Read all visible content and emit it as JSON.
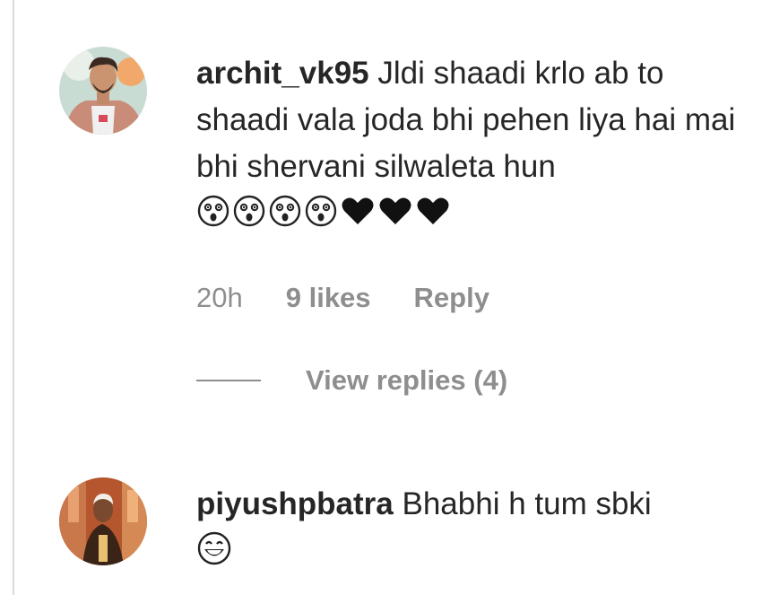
{
  "comments": [
    {
      "username": "archit_vk95",
      "text": "Jldi shaadi krlo ab to shaadi vala joda bhi pehen liya hai mai bhi shervani silwaleta hun",
      "emojis": [
        "astonished-face",
        "astonished-face",
        "astonished-face",
        "astonished-face",
        "black-heart",
        "black-heart",
        "black-heart"
      ],
      "time": "20h",
      "likes": "9 likes",
      "reply_label": "Reply",
      "view_replies": "View replies (4)"
    },
    {
      "username": "piyushpbatra",
      "text": "Bhabhi h tum sbki",
      "emojis": [
        "grinning-face"
      ]
    }
  ],
  "colors": {
    "text": "#262626",
    "secondary": "#8e8e8e",
    "border": "#dbdbdb"
  }
}
